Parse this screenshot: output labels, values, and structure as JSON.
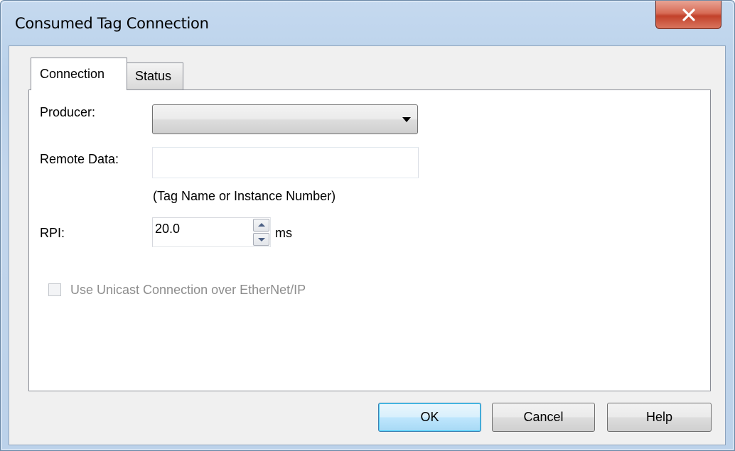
{
  "window": {
    "title": "Consumed Tag Connection",
    "close_label": "X"
  },
  "tabs": [
    {
      "label": "Connection",
      "active": true
    },
    {
      "label": "Status",
      "active": false
    }
  ],
  "form": {
    "producer_label": "Producer:",
    "producer_value": "",
    "remote_data_label": "Remote Data:",
    "remote_data_value": "",
    "remote_data_hint": "(Tag Name or Instance Number)",
    "rpi_label": "RPI:",
    "rpi_value": "20.0",
    "rpi_unit": "ms",
    "unicast_label": "Use Unicast Connection over EtherNet/IP",
    "unicast_checked": false,
    "unicast_enabled": false
  },
  "buttons": {
    "ok": "OK",
    "cancel": "Cancel",
    "help": "Help"
  },
  "colors": {
    "close_button": "#c2412a",
    "default_button_border": "#3c7fb1",
    "disabled_text": "#8d8d8d"
  }
}
